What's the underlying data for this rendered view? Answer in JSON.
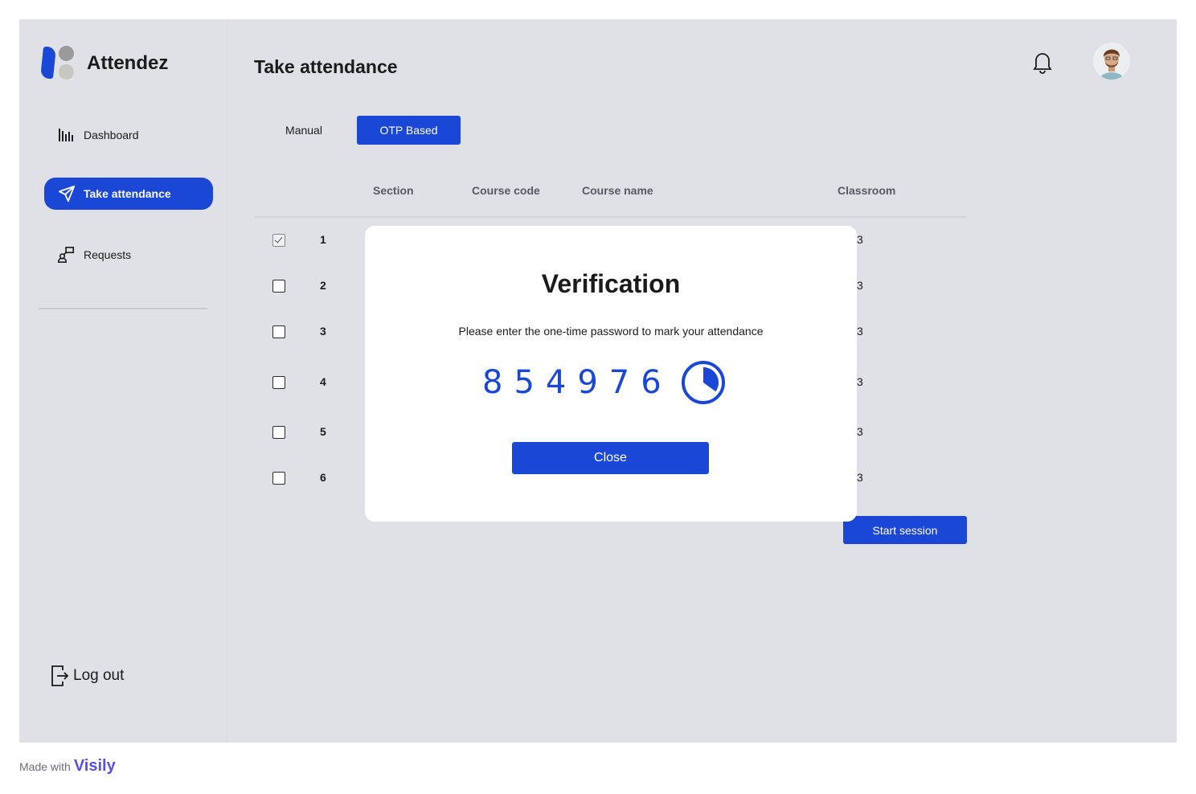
{
  "app": {
    "name": "Attendez"
  },
  "sidebar": {
    "items": [
      {
        "label": "Dashboard",
        "icon": "bar-chart-icon"
      },
      {
        "label": "Take attendance",
        "icon": "send-icon",
        "active": true
      },
      {
        "label": "Requests",
        "icon": "requests-icon"
      }
    ],
    "logout_label": "Log out"
  },
  "header": {
    "title": "Take attendance"
  },
  "tabs": [
    {
      "label": "Manual",
      "active": false
    },
    {
      "label": "OTP Based",
      "active": true
    }
  ],
  "table": {
    "columns": [
      "Section",
      "Course code",
      "Course name",
      "Classroom"
    ],
    "rows": [
      {
        "num": "1",
        "checked": true,
        "room_tail": "3"
      },
      {
        "num": "2",
        "checked": false,
        "room_tail": "3"
      },
      {
        "num": "3",
        "checked": false,
        "room_tail": "3"
      },
      {
        "num": "4",
        "checked": false,
        "room_tail": "3"
      },
      {
        "num": "5",
        "checked": false,
        "room_tail": "3"
      },
      {
        "num": "6",
        "checked": false,
        "room_tail": "3"
      }
    ]
  },
  "start_session_label": "Start session",
  "modal": {
    "title": "Verification",
    "message": "Please enter the one-time password to mark your attendance",
    "otp": "854976",
    "close_label": "Close",
    "timer_remaining_fraction": 0.35
  },
  "footer": {
    "made_with": "Made with",
    "brand": "Visily"
  },
  "colors": {
    "accent": "#1a47d6",
    "background": "#dfe1e6"
  }
}
